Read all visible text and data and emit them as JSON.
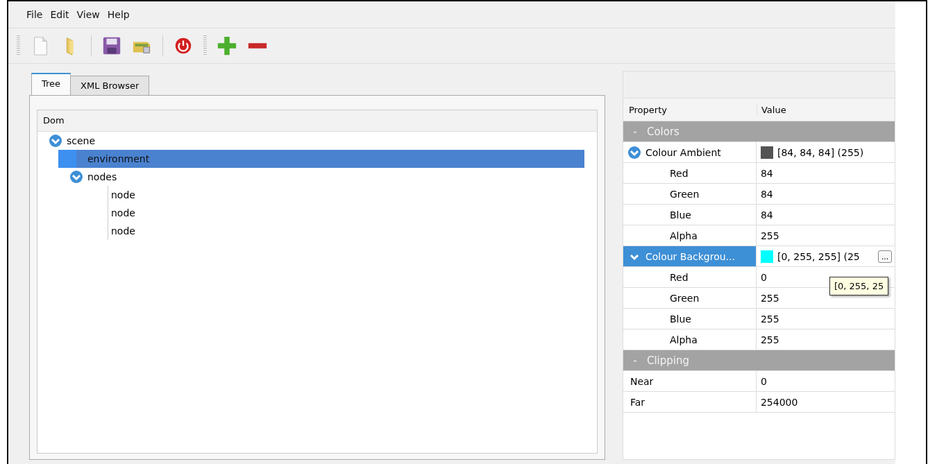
{
  "menu": [
    "File",
    "Edit",
    "View",
    "Help"
  ],
  "toolbar": {
    "groups": [
      [
        {
          "kind": "new"
        },
        {
          "kind": "open"
        },
        {
          "kind": "save"
        },
        {
          "kind": "export"
        },
        {
          "kind": "power"
        }
      ],
      [
        {
          "kind": "add"
        },
        {
          "kind": "remove"
        }
      ]
    ]
  },
  "tabs": [
    {
      "label": "Tree",
      "selected": true
    },
    {
      "label": "XML Browser",
      "selected": false
    }
  ],
  "tree": {
    "header": "Dom",
    "items": [
      {
        "label": "scene",
        "expanded": true,
        "selected": false,
        "children": [
          {
            "label": "environment",
            "selected": true
          },
          {
            "label": "nodes",
            "expanded": true,
            "selected": false,
            "children": [
              {
                "label": "node",
                "selected": false
              },
              {
                "label": "node",
                "selected": false
              },
              {
                "label": "node",
                "selected": false
              }
            ]
          }
        ]
      }
    ]
  },
  "properties": {
    "columns": [
      "Property",
      "Value"
    ],
    "rows": [
      {
        "kind": "group",
        "toggle": "-",
        "name": "Colors"
      },
      {
        "kind": "color",
        "name": "Colour Ambient",
        "value": "[84, 84, 84] (255)",
        "color": "#545454",
        "expanded": true,
        "selected": false,
        "children": [
          {
            "kind": "value",
            "name": "Red",
            "value": "84"
          },
          {
            "kind": "value",
            "name": "Green",
            "value": "84"
          },
          {
            "kind": "value",
            "name": "Blue",
            "value": "84"
          },
          {
            "kind": "value",
            "name": "Alpha",
            "value": "255"
          }
        ]
      },
      {
        "kind": "color",
        "name": "Colour Backgrou...",
        "value": "[0, 255, 255] (25",
        "color": "#00ffff",
        "expanded": true,
        "selected": true,
        "button": "...",
        "children": [
          {
            "kind": "value",
            "name": "Red",
            "value": "0"
          },
          {
            "kind": "value",
            "name": "Green",
            "value": "255"
          },
          {
            "kind": "value",
            "name": "Blue",
            "value": "255"
          },
          {
            "kind": "value",
            "name": "Alpha",
            "value": "255"
          }
        ]
      },
      {
        "kind": "group",
        "toggle": "-",
        "name": "Clipping"
      },
      {
        "kind": "value",
        "name": "Near",
        "value": "0"
      },
      {
        "kind": "value",
        "name": "Far",
        "value": "254000"
      }
    ],
    "tooltip": "[0, 255, 25"
  }
}
